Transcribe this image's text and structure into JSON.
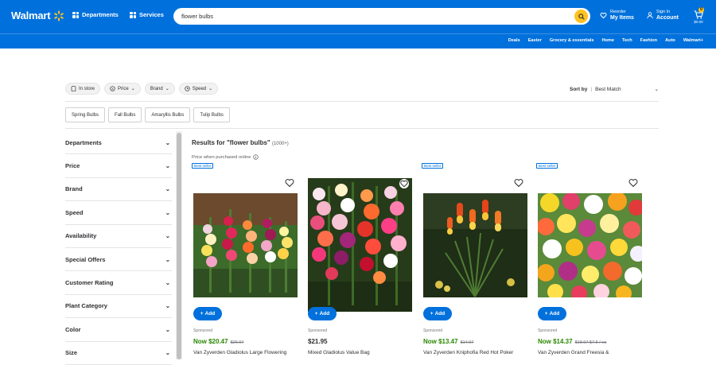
{
  "header": {
    "logo_text": "Walmart",
    "departments_label": "Departments",
    "services_label": "Services",
    "search_value": "flower bulbs",
    "reorder_top": "Reorder",
    "reorder_bottom": "My Items",
    "signin_top": "Sign In",
    "signin_bottom": "Account",
    "cart_count": "0",
    "cart_total": "$0.00",
    "brand_blue": "#0071dc",
    "accent_yellow": "#ffc220"
  },
  "subnav": {
    "items": [
      "Deals",
      "Easter",
      "Grocery & essentials",
      "Home",
      "Tech",
      "Fashion",
      "Auto",
      "Walmart+"
    ]
  },
  "filters": {
    "chips": [
      "In store",
      "Price",
      "Brand",
      "Speed"
    ],
    "sort_label": "Sort by",
    "sort_value": "Best Match"
  },
  "categories": [
    "Spring Bulbs",
    "Fall Bulbs",
    "Amaryllis Bulbs",
    "Tulip Bulbs"
  ],
  "sidebar": {
    "items": [
      "Departments",
      "Price",
      "Brand",
      "Speed",
      "Availability",
      "Special Offers",
      "Customer Rating",
      "Plant Category",
      "Color",
      "Size"
    ]
  },
  "results": {
    "title": "Results for \"flower bulbs\"",
    "count": "(1000+)",
    "price_note": "Price when purchased online",
    "add_label": "Add",
    "products": [
      {
        "badge": "Best seller",
        "sponsored": "Sponsored",
        "price": "Now $20.47",
        "was": "$26.97",
        "title": "Van Zyverden Gladiolus Large Flowering"
      },
      {
        "badge": "",
        "sponsored": "Sponsored",
        "price": "$21.95",
        "was": "",
        "title": "Mixed Gladiolus Value Bag"
      },
      {
        "badge": "Best seller",
        "sponsored": "Sponsored",
        "price": "Now $13.47",
        "was": "$14.97",
        "title": "Van Zyverden Kniphofia Red Hot Poker"
      },
      {
        "badge": "Best seller",
        "sponsored": "Sponsored",
        "price": "Now $14.37",
        "was": "$18.97 $7.5 / ea",
        "title": "Van Zyverden Grand Freesia &"
      }
    ]
  }
}
